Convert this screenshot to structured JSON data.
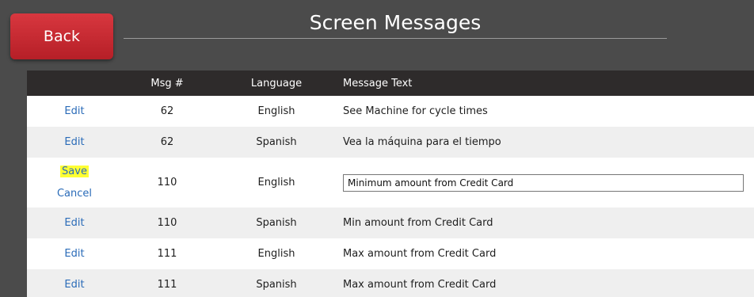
{
  "header": {
    "back_label": "Back",
    "title": "Screen Messages"
  },
  "table": {
    "columns": [
      "",
      "Msg #",
      "Language",
      "Message Text"
    ],
    "rows": [
      {
        "action": "Edit",
        "msg": "62",
        "language": "English",
        "text": "See Machine for cycle times"
      },
      {
        "action": "Edit",
        "msg": "62",
        "language": "Spanish",
        "text": "Vea la máquina para el tiempo"
      },
      {
        "save": "Save",
        "cancel": "Cancel",
        "msg": "110",
        "language": "English",
        "text": "Minimum amount from Credit Card"
      },
      {
        "action": "Edit",
        "msg": "110",
        "language": "Spanish",
        "text": "Min amount from Credit Card"
      },
      {
        "action": "Edit",
        "msg": "111",
        "language": "English",
        "text": "Max amount from Credit Card"
      },
      {
        "action": "Edit",
        "msg": "111",
        "language": "Spanish",
        "text": "Max amount from Credit Card"
      }
    ]
  },
  "colors": {
    "back_button": "#c9272f",
    "background": "#4b4b4b",
    "header_row": "#2e2b2b",
    "link": "#2a6bb8",
    "highlight": "#ffff33"
  }
}
